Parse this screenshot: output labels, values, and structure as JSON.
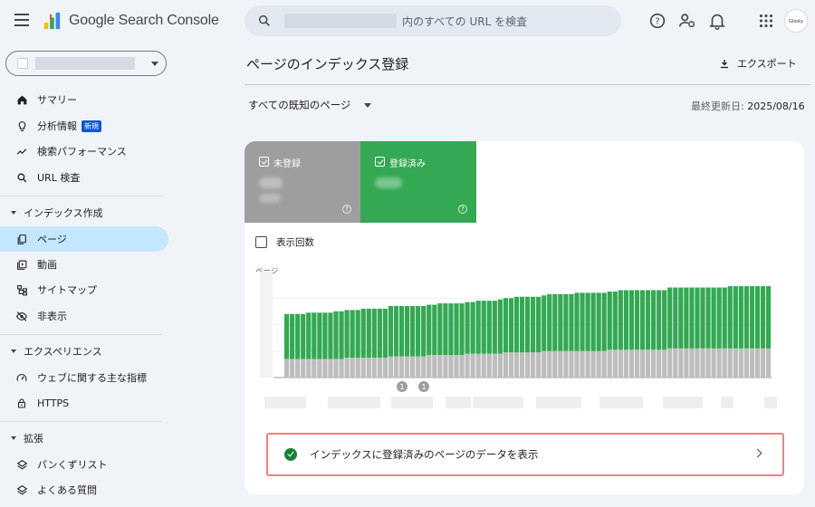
{
  "app": {
    "title": "Google Search Console",
    "avatar_text": "Glosty"
  },
  "search": {
    "placeholder": "内のすべての URL を検査"
  },
  "sidebar": {
    "items": [
      {
        "label": "サマリー",
        "icon": "home-icon"
      },
      {
        "label": "分析情報",
        "icon": "lightbulb-icon",
        "badge": "新規"
      },
      {
        "label": "検索パフォーマンス",
        "icon": "trending-up-icon"
      },
      {
        "label": "URL 検査",
        "icon": "search-icon"
      }
    ],
    "section_index": {
      "label": "インデックス作成",
      "items": [
        {
          "label": "ページ",
          "icon": "pages-icon",
          "active": true
        },
        {
          "label": "動画",
          "icon": "video-icon"
        },
        {
          "label": "サイトマップ",
          "icon": "sitemap-icon"
        },
        {
          "label": "非表示",
          "icon": "visibility-off-icon"
        }
      ]
    },
    "section_experience": {
      "label": "エクスペリエンス",
      "items": [
        {
          "label": "ウェブに関する主な指標",
          "icon": "speed-icon"
        },
        {
          "label": "HTTPS",
          "icon": "lock-icon"
        }
      ]
    },
    "section_extensions": {
      "label": "拡張",
      "items": [
        {
          "label": "パンくずリスト",
          "icon": "layers-icon"
        },
        {
          "label": "よくある質問",
          "icon": "layers-icon"
        }
      ]
    }
  },
  "main": {
    "title": "ページのインデックス登録",
    "export_label": "エクスポート",
    "filter_label": "すべての既知のページ",
    "updated_label": "最終更新日:",
    "updated_date": "2025/08/16",
    "tiles": [
      {
        "label": "未登録",
        "color": "#9e9e9e"
      },
      {
        "label": "登録済み",
        "color": "#34a853"
      }
    ],
    "impressions_label": "表示回数",
    "cta_label": "インデックスに登録済みのページのデータを表示"
  },
  "chart_data": {
    "type": "bar",
    "stacked": true,
    "ylabel": "ページ",
    "annotations": [
      "1",
      "1"
    ],
    "series": [
      {
        "name": "未登録",
        "color": "#bdbdbd",
        "values": [
          14,
          14,
          14,
          14,
          14,
          14,
          14,
          14,
          14,
          14,
          14,
          15,
          15,
          15,
          15,
          15,
          15,
          15,
          15,
          16,
          16,
          16,
          16,
          16,
          16,
          16,
          17,
          17,
          17,
          17,
          17,
          17,
          17,
          18,
          18,
          18,
          18,
          18,
          18,
          18,
          19,
          19,
          19,
          19,
          19,
          19,
          19,
          20,
          20,
          20,
          20,
          20,
          20,
          20,
          20,
          20,
          20,
          20,
          20,
          21,
          21,
          21,
          21,
          21,
          21,
          21,
          21,
          21,
          21,
          21,
          22,
          22,
          22,
          22,
          22,
          22,
          22,
          22,
          22,
          22,
          22,
          22,
          22,
          22,
          22,
          22,
          22,
          22,
          22
        ]
      },
      {
        "name": "登録済み",
        "color": "#34a853",
        "values": [
          34,
          34,
          34,
          34,
          35,
          35,
          35,
          35,
          35,
          36,
          36,
          36,
          36,
          36,
          37,
          37,
          37,
          37,
          37,
          38,
          38,
          38,
          38,
          38,
          38,
          38,
          38,
          38,
          39,
          39,
          39,
          39,
          39,
          39,
          39,
          40,
          40,
          40,
          40,
          41,
          41,
          41,
          42,
          42,
          42,
          42,
          42,
          42,
          43,
          43,
          43,
          43,
          43,
          44,
          44,
          44,
          44,
          44,
          44,
          44,
          44,
          45,
          45,
          45,
          45,
          45,
          45,
          45,
          45,
          45,
          46,
          46,
          46,
          46,
          46,
          46,
          46,
          46,
          46,
          46,
          46,
          47,
          47,
          47,
          47,
          47,
          47,
          47,
          47
        ]
      }
    ],
    "ylim": [
      0,
      80
    ]
  }
}
